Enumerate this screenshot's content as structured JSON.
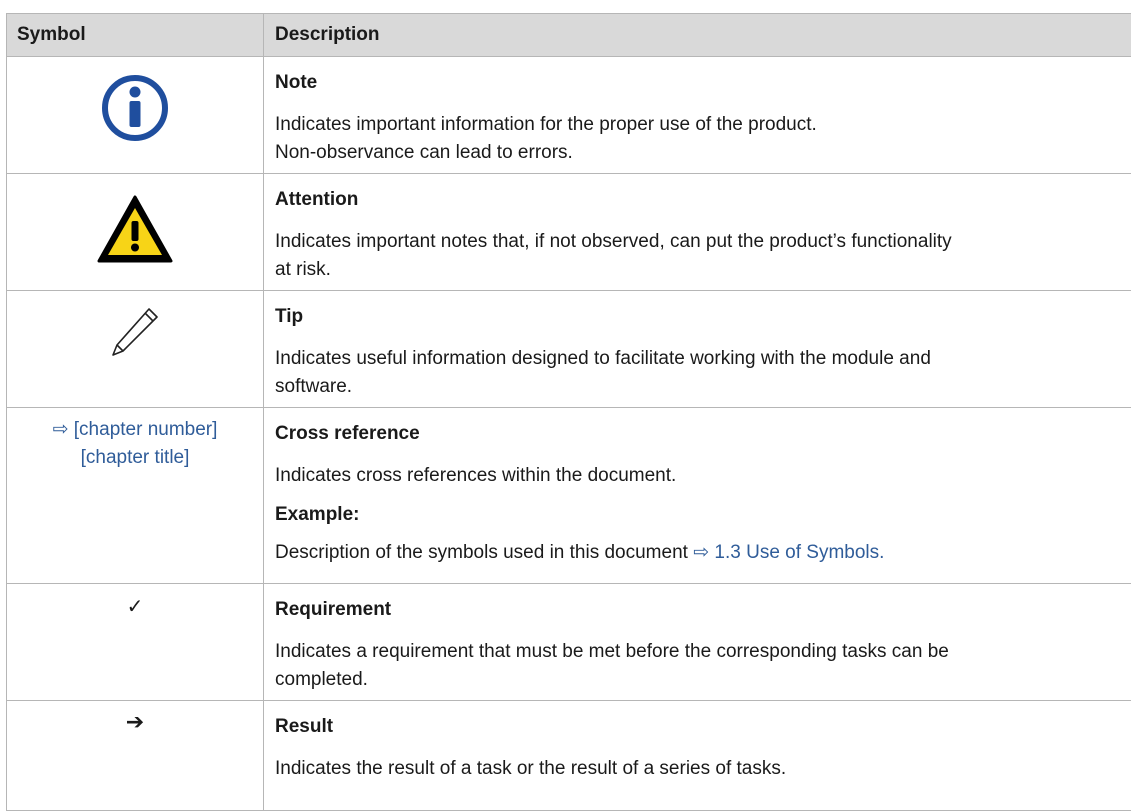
{
  "header": {
    "symbol_label": "Symbol",
    "description_label": "Description"
  },
  "rows": [
    {
      "icon": "info-circle-icon",
      "title": "Note",
      "lines": [
        "Indicates important information for the proper use of the product.",
        "Non-observance can lead to errors."
      ]
    },
    {
      "icon": "warning-triangle-icon",
      "title": "Attention",
      "lines": [
        "Indicates important notes that, if not observed, can put the product’s functionality",
        "at risk."
      ]
    },
    {
      "icon": "pencil-icon",
      "title": "Tip",
      "lines": [
        "Indicates useful information designed to facilitate working with the module and",
        "software."
      ]
    },
    {
      "symbol_lines": [
        "⇨ [chapter number]",
        "[chapter title]"
      ],
      "title": "Cross reference",
      "line": "Indicates cross references within the document.",
      "example_label": "Example:",
      "example_text": "Description of the symbols used in this document ",
      "example_link": "⇨ 1.3 Use of Symbols."
    },
    {
      "symbol": "✓",
      "icon": "checkmark-icon",
      "title": "Requirement",
      "lines": [
        "Indicates a requirement that must be met before the corresponding tasks can be",
        "completed."
      ]
    },
    {
      "symbol": "➔",
      "icon": "right-arrow-icon",
      "title": "Result",
      "lines": [
        "Indicates the result of a task or the result of a series of tasks."
      ]
    }
  ],
  "colors": {
    "header_bg": "#d9d9d9",
    "border": "#b6b6b6",
    "info_blue": "#1f4e9e",
    "warning_yellow": "#f7d417",
    "link_blue": "#2f5c99"
  }
}
